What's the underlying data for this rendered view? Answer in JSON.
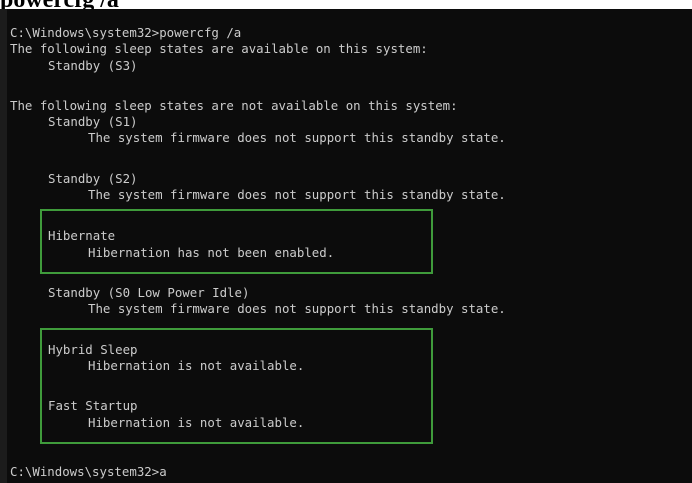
{
  "caption": "powercfg /a",
  "console": {
    "command_line": "C:\\Windows\\system32>powercfg /a",
    "available_heading": "The following sleep states are available on this system:",
    "available_states": [
      {
        "name": "Standby (S3)"
      }
    ],
    "unavailable_heading": "The following sleep states are not available on this system:",
    "unavailable_states": [
      {
        "name": "Standby (S1)",
        "reason": "The system firmware does not support this standby state."
      },
      {
        "name": "Standby (S2)",
        "reason": "The system firmware does not support this standby state."
      },
      {
        "name": "Hibernate",
        "reason": "Hibernation has not been enabled."
      },
      {
        "name": "Standby (S0 Low Power Idle)",
        "reason": "The system firmware does not support this standby state."
      },
      {
        "name": "Hybrid Sleep",
        "reason": "Hibernation is not available."
      },
      {
        "name": "Fast Startup",
        "reason": "Hibernation is not available."
      }
    ],
    "prompt": "C:\\Windows\\system32>a"
  },
  "colors": {
    "background": "#0c0c0c",
    "text": "#cccccc",
    "highlight_border": "#3f9b3b"
  }
}
